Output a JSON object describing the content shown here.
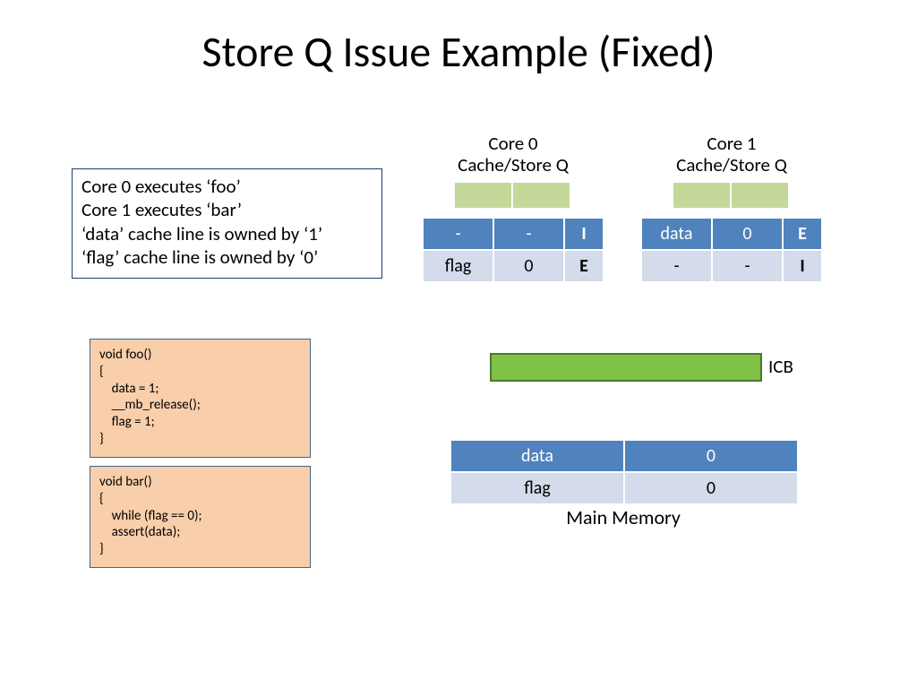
{
  "title": "Store Q Issue Example (Fixed)",
  "description": {
    "l1": "Core 0 executes ‘foo’",
    "l2": "Core 1 executes ‘bar’",
    "l3": "‘data’ cache line is owned by ‘1’",
    "l4": "‘flag’ cache line is owned by ‘0’"
  },
  "core0": {
    "label_l1": "Core 0",
    "label_l2": "Cache/Store Q",
    "r1": {
      "name": "-",
      "val": "-",
      "state": "I"
    },
    "r2": {
      "name": "flag",
      "val": "0",
      "state": "E"
    }
  },
  "core1": {
    "label_l1": "Core 1",
    "label_l2": "Cache/Store Q",
    "r1": {
      "name": "data",
      "val": "0",
      "state": "E"
    },
    "r2": {
      "name": "-",
      "val": "-",
      "state": "I"
    }
  },
  "icb_label": "ICB",
  "main_memory": {
    "label": "Main Memory",
    "r1": {
      "name": "data",
      "val": "0"
    },
    "r2": {
      "name": "flag",
      "val": "0"
    }
  },
  "code_foo": "void foo()\n{\n    data = 1;\n    __mb_release();\n    flag = 1;\n}",
  "code_bar": "void bar()\n{\n    while (flag == 0);\n    assert(data);\n}"
}
